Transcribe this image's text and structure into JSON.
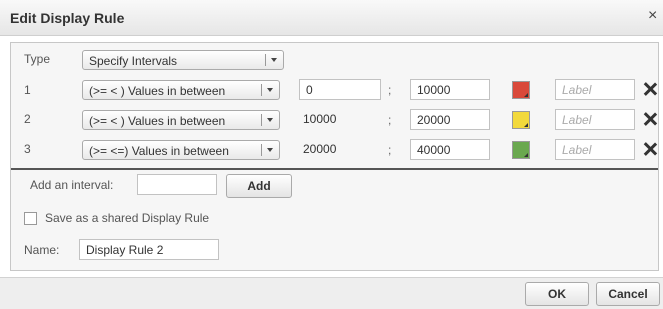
{
  "dialog": {
    "title": "Edit Display Rule",
    "close_glyph": "×"
  },
  "type_row": {
    "label": "Type",
    "selected": "Specify Intervals"
  },
  "intervals": [
    {
      "index": "1",
      "operator": "(>= < ) Values in between",
      "from": "0",
      "from_editable": true,
      "separator": ";",
      "to": "10000",
      "color": "#d9493a",
      "label_placeholder": "Label"
    },
    {
      "index": "2",
      "operator": "(>= < ) Values in between",
      "from": "10000",
      "from_editable": false,
      "separator": ";",
      "to": "20000",
      "color": "#f2d93b",
      "label_placeholder": "Label"
    },
    {
      "index": "3",
      "operator": "(>= <=) Values in between",
      "from": "20000",
      "from_editable": false,
      "separator": ";",
      "to": "40000",
      "color": "#6aa84f",
      "label_placeholder": "Label"
    }
  ],
  "add_interval": {
    "label": "Add an interval:",
    "value": "",
    "button": "Add"
  },
  "shared": {
    "label": "Save as a shared Display Rule",
    "checked": false
  },
  "name_field": {
    "label": "Name:",
    "value": "Display Rule 2"
  },
  "footer": {
    "ok": "OK",
    "cancel": "Cancel"
  },
  "icons": {
    "remove": "x-icon",
    "dropdown": "chevron-down-icon"
  }
}
